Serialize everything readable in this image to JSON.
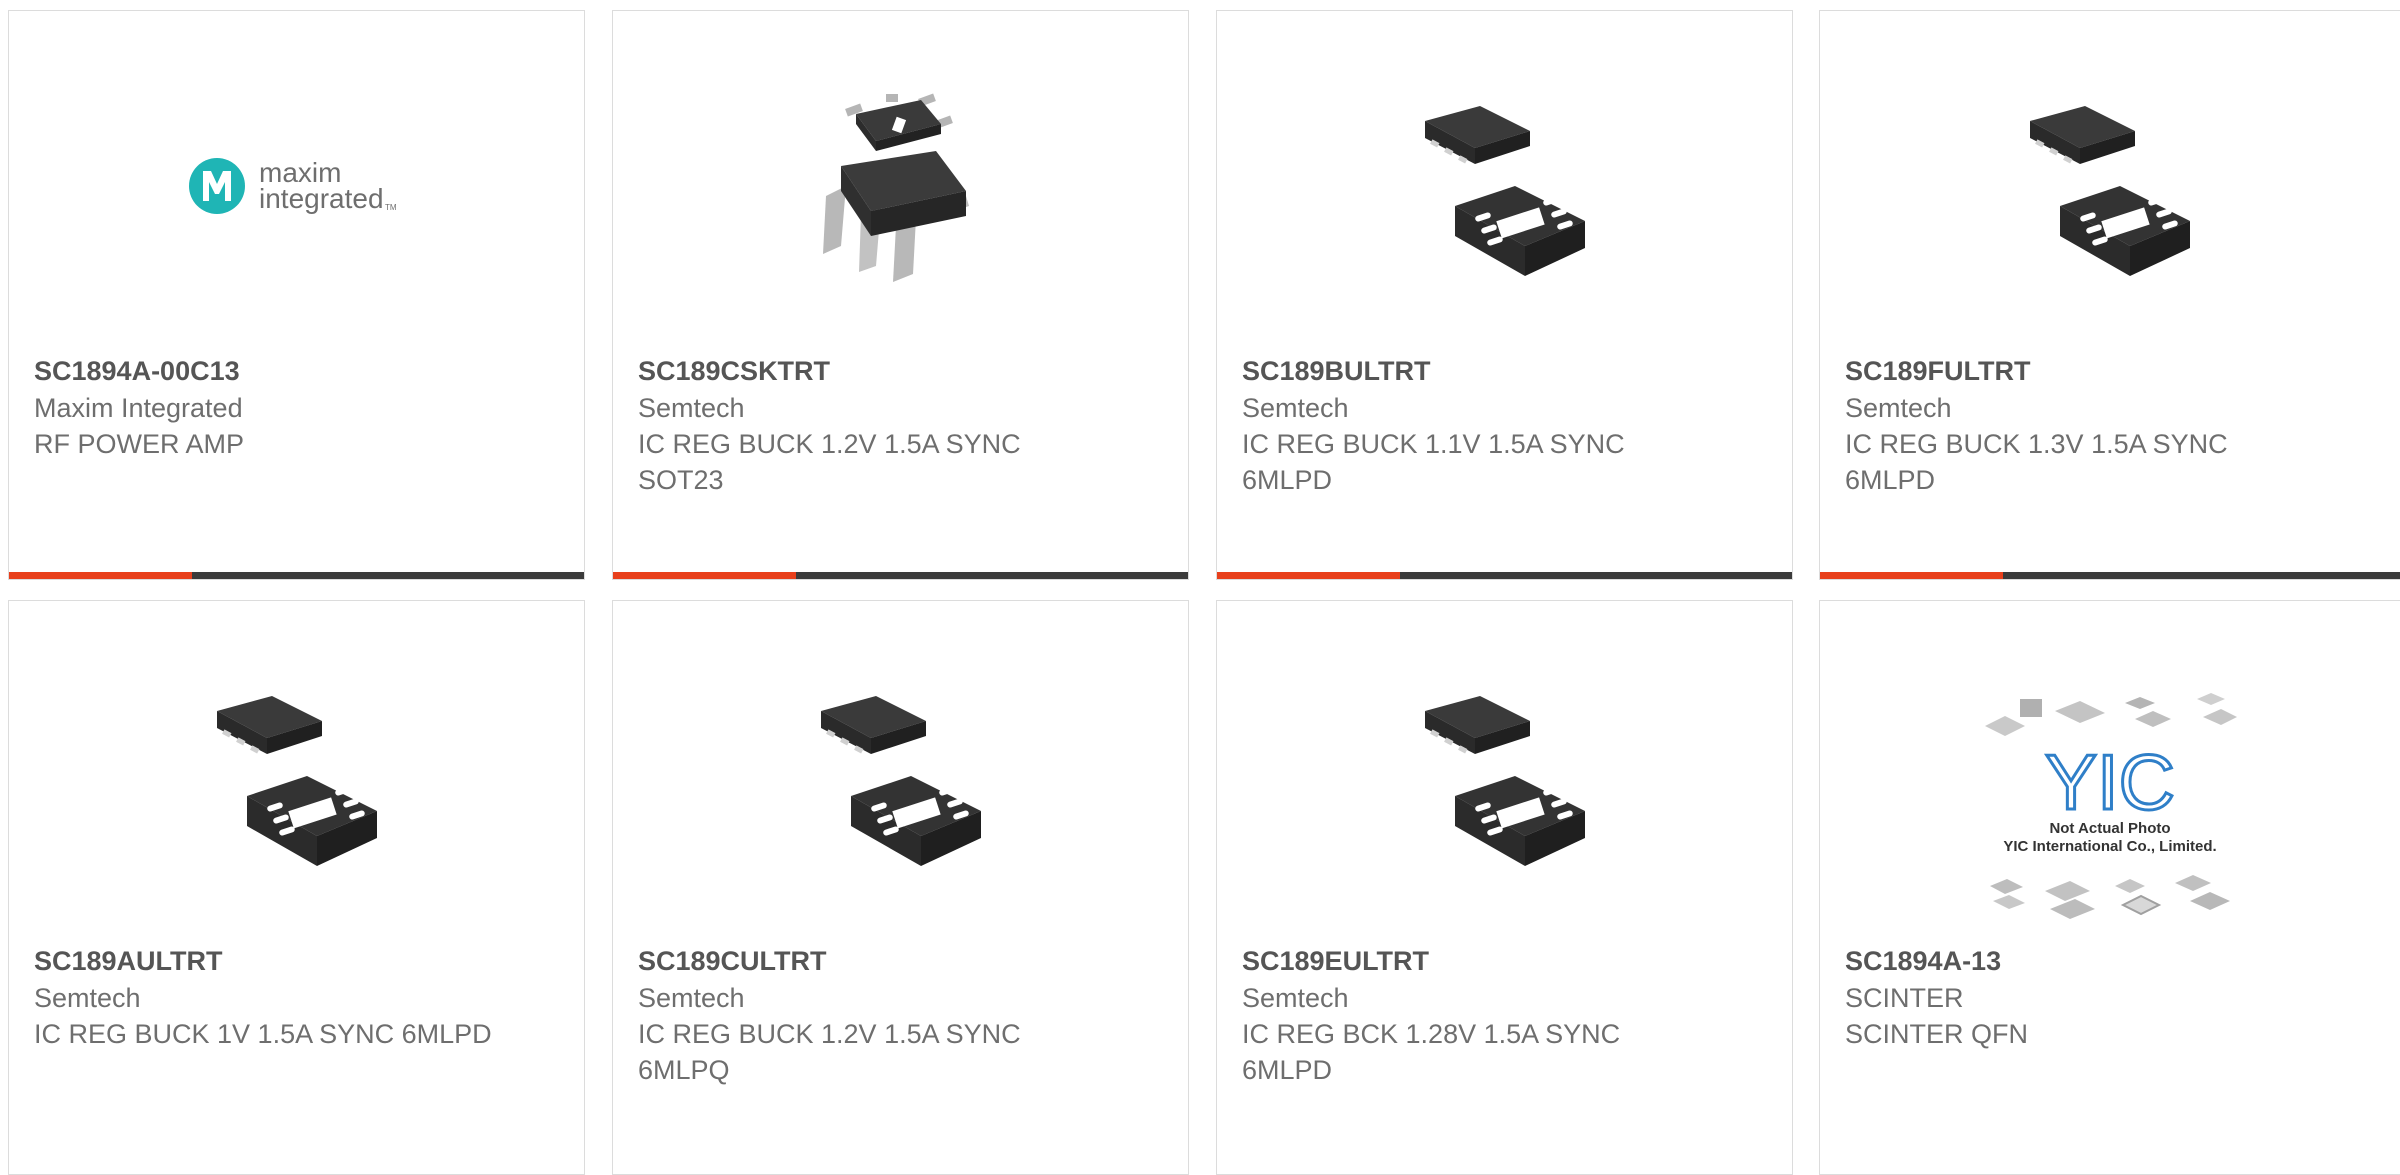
{
  "products": [
    {
      "part_number": "SC1894A-00C13",
      "manufacturer": "Maxim Integrated",
      "description": "RF POWER AMP",
      "image": "maxim-integrated-logo",
      "logo_text_line1": "maxim",
      "logo_text_line2": "integrated",
      "logo_tm": "TM"
    },
    {
      "part_number": "SC189CSKTRT",
      "manufacturer": "Semtech",
      "description": "IC REG BUCK 1.2V 1.5A SYNC SOT23",
      "image": "sot23-chip-package"
    },
    {
      "part_number": "SC189BULTRT",
      "manufacturer": "Semtech",
      "description": "IC REG BUCK 1.1V 1.5A SYNC 6MLPD",
      "image": "mlpd-chip-package"
    },
    {
      "part_number": "SC189FULTRT",
      "manufacturer": "Semtech",
      "description": "IC REG BUCK 1.3V 1.5A SYNC 6MLPD",
      "image": "mlpd-chip-package"
    },
    {
      "part_number": "SC189AULTRT",
      "manufacturer": "Semtech",
      "description": "IC REG BUCK 1V 1.5A SYNC 6MLPD",
      "image": "mlpd-chip-package"
    },
    {
      "part_number": "SC189CULTRT",
      "manufacturer": "Semtech",
      "description": "IC REG BUCK 1.2V 1.5A SYNC 6MLPQ",
      "image": "mlpd-chip-package"
    },
    {
      "part_number": "SC189EULTRT",
      "manufacturer": "Semtech",
      "description": "IC REG BCK 1.28V 1.5A SYNC 6MLPD",
      "image": "mlpd-chip-package"
    },
    {
      "part_number": "SC1894A-13",
      "manufacturer": "SCINTER",
      "description": "SCINTER QFN",
      "image": "yic-placeholder",
      "placeholder_logo": "YIC",
      "placeholder_line1": "Not Actual Photo",
      "placeholder_line2": "YIC International Co., Limited."
    }
  ],
  "colors": {
    "accent": "#e8401c",
    "bar": "#3b3b3b",
    "part_text": "#555555",
    "body_text": "#6e6e6e",
    "maxim_teal": "#1fb5b5",
    "yic_blue": "#2f7fc8"
  }
}
